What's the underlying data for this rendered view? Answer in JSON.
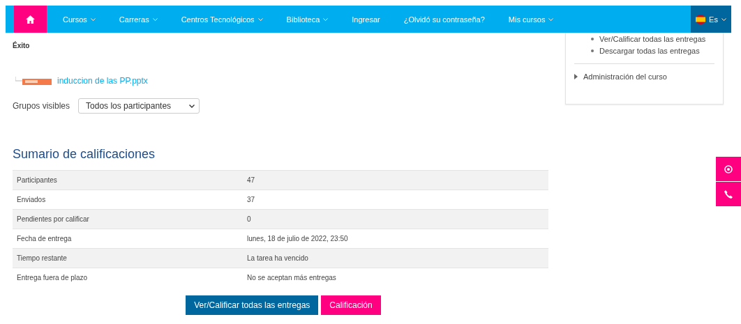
{
  "navbar": {
    "items": [
      {
        "label": "Cursos",
        "dropdown": true
      },
      {
        "label": "Carreras",
        "dropdown": true
      },
      {
        "label": "Centros Tecnológicos",
        "dropdown": true
      },
      {
        "label": "Biblioteca",
        "dropdown": true
      },
      {
        "label": "Ingresar",
        "dropdown": false
      },
      {
        "label": "¿Olvidó su contraseña?",
        "dropdown": false
      },
      {
        "label": "Mis cursos",
        "dropdown": true
      }
    ],
    "language": "Es"
  },
  "status": "Éxito",
  "file": {
    "name": "induccion de las PP.pptx"
  },
  "groups": {
    "label": "Grupos visibles",
    "value": "Todos los participantes"
  },
  "summary": {
    "title": "Sumario de calificaciones",
    "rows": [
      {
        "label": "Participantes",
        "value": "47"
      },
      {
        "label": "Enviados",
        "value": "37"
      },
      {
        "label": "Pendientes por calificar",
        "value": "0"
      },
      {
        "label": "Fecha de entrega",
        "value": "lunes, 18 de julio de 2022, 23:50"
      },
      {
        "label": "Tiempo restante",
        "value": "La tarea ha vencido"
      },
      {
        "label": "Entrega fuera de plazo",
        "value": "No se aceptan más entregas"
      }
    ]
  },
  "buttons": [
    {
      "label": "Ver/Calificar todas las entregas",
      "kind": "primary"
    },
    {
      "label": "Calificación",
      "kind": "secondary"
    }
  ],
  "sidebar": {
    "links": [
      "Ver/Calificar todas las entregas",
      "Descargar todas las entregas"
    ],
    "section": "Administración del curso"
  }
}
